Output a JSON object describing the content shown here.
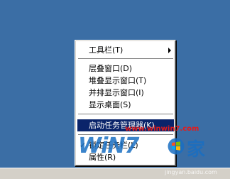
{
  "context_menu": {
    "items": [
      {
        "label": "工具栏(T)",
        "submenu": true
      },
      {
        "label": "层叠窗口(D)"
      },
      {
        "label": "堆叠显示窗口(T)"
      },
      {
        "label": "并排显示窗口(I)"
      },
      {
        "label": "显示桌面(S)"
      },
      {
        "label": "启动任务管理器(K)",
        "highlighted": true
      },
      {
        "label": "锁定任务栏(L)",
        "checked": true
      },
      {
        "label": "属性(R)"
      }
    ],
    "check_mark": "✓"
  },
  "watermark": {
    "url": "www.winwin7.com",
    "logo_text": "WiN7",
    "logo_suffix": "家",
    "bottom_text": "jingyan.baidu.com"
  },
  "colors": {
    "desktop": "#3b6ea5",
    "menu_bg": "#ffffff",
    "highlight": "#0a246a",
    "watermark_red": "#e31b1b",
    "watermark_blue": "#1a6fc2"
  }
}
